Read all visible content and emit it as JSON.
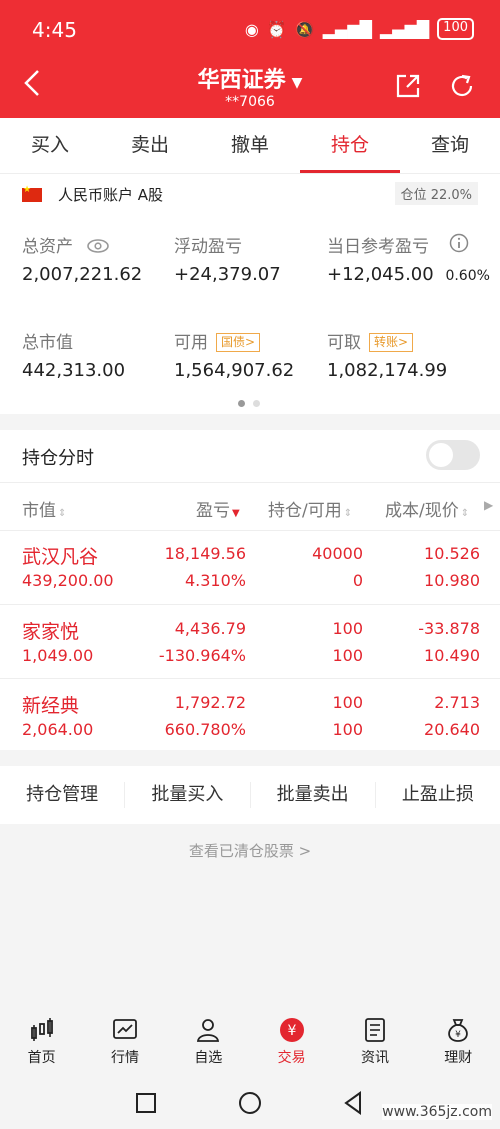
{
  "status_bar": {
    "time": "4:45",
    "battery": "100"
  },
  "header": {
    "title": "华西证券",
    "account_masked": "**7066"
  },
  "tabs": [
    "买入",
    "卖出",
    "撤单",
    "持仓",
    "查询"
  ],
  "account": {
    "name": "人民币账户 A股",
    "position_ratio": "仓位 22.0%",
    "total_assets_label": "总资产",
    "total_assets": "2,007,221.62",
    "float_pnl_label": "浮动盈亏",
    "float_pnl": "+24,379.07",
    "day_pnl_label": "当日参考盈亏",
    "day_pnl": "+12,045.00",
    "day_pnl_pct": "0.60%",
    "market_value_label": "总市值",
    "market_value": "442,313.00",
    "available_label": "可用",
    "available_tag": "国债>",
    "available": "1,564,907.62",
    "withdrawable_label": "可取",
    "withdrawable_tag": "转账>",
    "withdrawable": "1,082,174.99"
  },
  "holdings": {
    "title": "持仓分时",
    "columns": [
      "市值",
      "盈亏",
      "持仓/可用",
      "成本/现价"
    ],
    "rows": [
      {
        "name": "武汉凡谷",
        "market_value": "439,200.00",
        "pnl": "18,149.56",
        "pnl_pct": "4.310%",
        "position": "40000",
        "available": "0",
        "cost": "10.526",
        "price": "10.980"
      },
      {
        "name": "家家悦",
        "market_value": "1,049.00",
        "pnl": "4,436.79",
        "pnl_pct": "-130.964%",
        "position": "100",
        "available": "100",
        "cost": "-33.878",
        "price": "10.490"
      },
      {
        "name": "新经典",
        "market_value": "2,064.00",
        "pnl": "1,792.72",
        "pnl_pct": "660.780%",
        "position": "100",
        "available": "100",
        "cost": "2.713",
        "price": "20.640"
      }
    ]
  },
  "actions": [
    "持仓管理",
    "批量买入",
    "批量卖出",
    "止盈止损"
  ],
  "cleared_link": "查看已清仓股票 >",
  "bottom_nav": [
    "首页",
    "行情",
    "自选",
    "交易",
    "资讯",
    "理财"
  ],
  "watermark": "www.365jz.com",
  "colors": {
    "brand_red": "#ee2e34",
    "tag_orange": "#e89a2c"
  }
}
